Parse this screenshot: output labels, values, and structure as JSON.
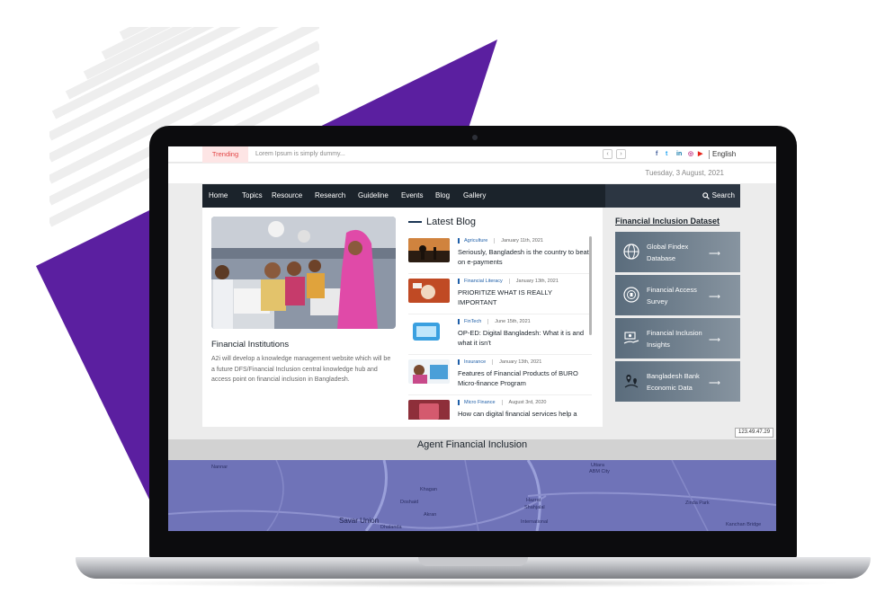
{
  "topbar": {
    "trending_label": "Trending",
    "ticker_text": "Lorem Ipsum is simply dummy...",
    "prev_glyph": "‹",
    "next_glyph": "›",
    "social": [
      {
        "icon": "facebook-icon",
        "glyph": "f",
        "color": "#3b5998"
      },
      {
        "icon": "twitter-icon",
        "glyph": "t",
        "color": "#1da1f2"
      },
      {
        "icon": "linkedin-icon",
        "glyph": "in",
        "color": "#0e76a8"
      },
      {
        "icon": "instagram-icon",
        "glyph": "◎",
        "color": "#c13584"
      },
      {
        "icon": "youtube-icon",
        "glyph": "▶",
        "color": "#e62117"
      }
    ],
    "language": "English"
  },
  "date": "Tuesday, 3 August, 2021",
  "nav": {
    "items": [
      "Home",
      "Topics",
      "Resource",
      "Research",
      "Guideline",
      "Events",
      "Blog",
      "Gallery"
    ],
    "search_label": "Search"
  },
  "featured": {
    "title": "Financial Institutions",
    "description": "A2i will develop a knowledge management website which will be a future DFS/Financial Inclusion central knowledge hub and access point on financial inclusion in Bangladesh."
  },
  "latest_blog": {
    "heading": "Latest Blog",
    "posts": [
      {
        "category": "Agriculture",
        "date": "January 11th, 2021",
        "title": "Seriously, Bangladesh is the country to beat on e-payments"
      },
      {
        "category": "Financial Literacy",
        "date": "January 13th, 2021",
        "title": "PRIORITIZE WHAT IS REALLY IMPORTANT"
      },
      {
        "category": "FinTech",
        "date": "June 15th, 2021",
        "title": "OP-ED: Digital Bangladesh: What it is and what it isn't"
      },
      {
        "category": "Insurance",
        "date": "January 13th, 2021",
        "title": "Features of Financial Products of BURO Micro-finance Program"
      },
      {
        "category": "Micro Finance",
        "date": "August 3rd, 2020",
        "title": "How can digital financial services help a"
      }
    ]
  },
  "dataset": {
    "heading": "Financial Inclusion Dataset",
    "cards": [
      {
        "label": "Global Findex Database",
        "icon": "globe-icon"
      },
      {
        "label": "Financial Access Survey",
        "icon": "imf-seal-icon"
      },
      {
        "label": "Financial Inclusion Insights",
        "icon": "money-hand-icon"
      },
      {
        "label": "Bangladesh Bank Economic Data",
        "icon": "map-pin-icon"
      }
    ],
    "arrow_glyph": "⟶"
  },
  "ip_address": "123.49.47.29",
  "agent_section": {
    "title": "Agent Financial Inclusion",
    "map_labels": {
      "savar_union": "Savar Union",
      "uttara": "Uttara",
      "abm_city": "ABM City",
      "zinda_park": "Zinda Park",
      "hazrat": "Hazrat",
      "shahjalal": "Shahjalal",
      "international": "International",
      "khagan": "Khagan",
      "akran": "Akran",
      "dosahid": "Doshaid",
      "nannar": "Nannar",
      "kanchan_bridge": "Kanchan Bridge",
      "dhalanda": "Dhalanda"
    }
  },
  "colors": {
    "purple": "#5b1fa0",
    "navbar": "#1b232b",
    "trending_bg": "#fde5e5",
    "trending_text": "#e24545",
    "category_blue": "#1f5fa8",
    "map": "#6f73b8"
  }
}
